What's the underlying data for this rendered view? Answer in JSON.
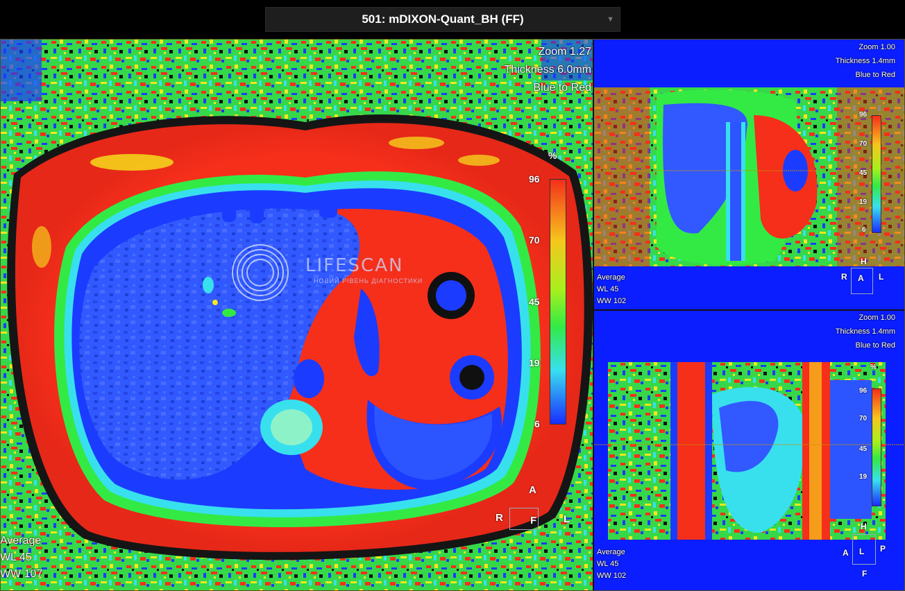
{
  "header": {
    "series_title": "501: mDIXON-Quant_BH (FF)"
  },
  "main_view": {
    "zoom": "Zoom 1.27",
    "thickness": "Thickness 6.0mm",
    "colormap": "Blue to Red",
    "stats": {
      "label": "Average",
      "wl": "WL    45",
      "ww": "WW   107"
    },
    "scale": {
      "unit": "%",
      "ticks": [
        "96",
        "70",
        "45",
        "19",
        "6"
      ]
    },
    "orientation": {
      "top": "A",
      "left": "R",
      "bottom": "F",
      "right": "L"
    }
  },
  "coronal_view": {
    "zoom": "Zoom 1.00",
    "thickness": "Thickness 1.4mm",
    "colormap": "Blue to Red",
    "stats": {
      "label": "Average",
      "wl": "WL     45",
      "ww": "WW    102"
    },
    "scale": {
      "ticks": [
        "96",
        "70",
        "45",
        "19",
        "6"
      ]
    },
    "orientation": {
      "top": "H",
      "left": "R",
      "center": "A",
      "right": "L"
    }
  },
  "sagittal_view": {
    "zoom": "Zoom 1.00",
    "thickness": "Thickness 1.4mm",
    "colormap": "Blue to Red",
    "stats": {
      "label": "Average",
      "wl": "WL     45",
      "ww": "WW    102"
    },
    "scale": {
      "unit": "%",
      "ticks": [
        "96",
        "70",
        "45",
        "19"
      ]
    },
    "orientation": {
      "top": "H",
      "left": "A",
      "center": "L",
      "right": "P",
      "bottom": "F"
    }
  },
  "watermark": {
    "brand": "LIFESCAN",
    "tagline": "НОВИЙ РІВЕНЬ ДІАГНОСТИКИ"
  },
  "colors": {
    "fat_red": "#f52f1a",
    "liver_blue": "#2d55ff",
    "bg_blue": "#0a1eff",
    "green": "#33ea45",
    "yellow": "#f6e61c",
    "cyan": "#38e0ee"
  }
}
